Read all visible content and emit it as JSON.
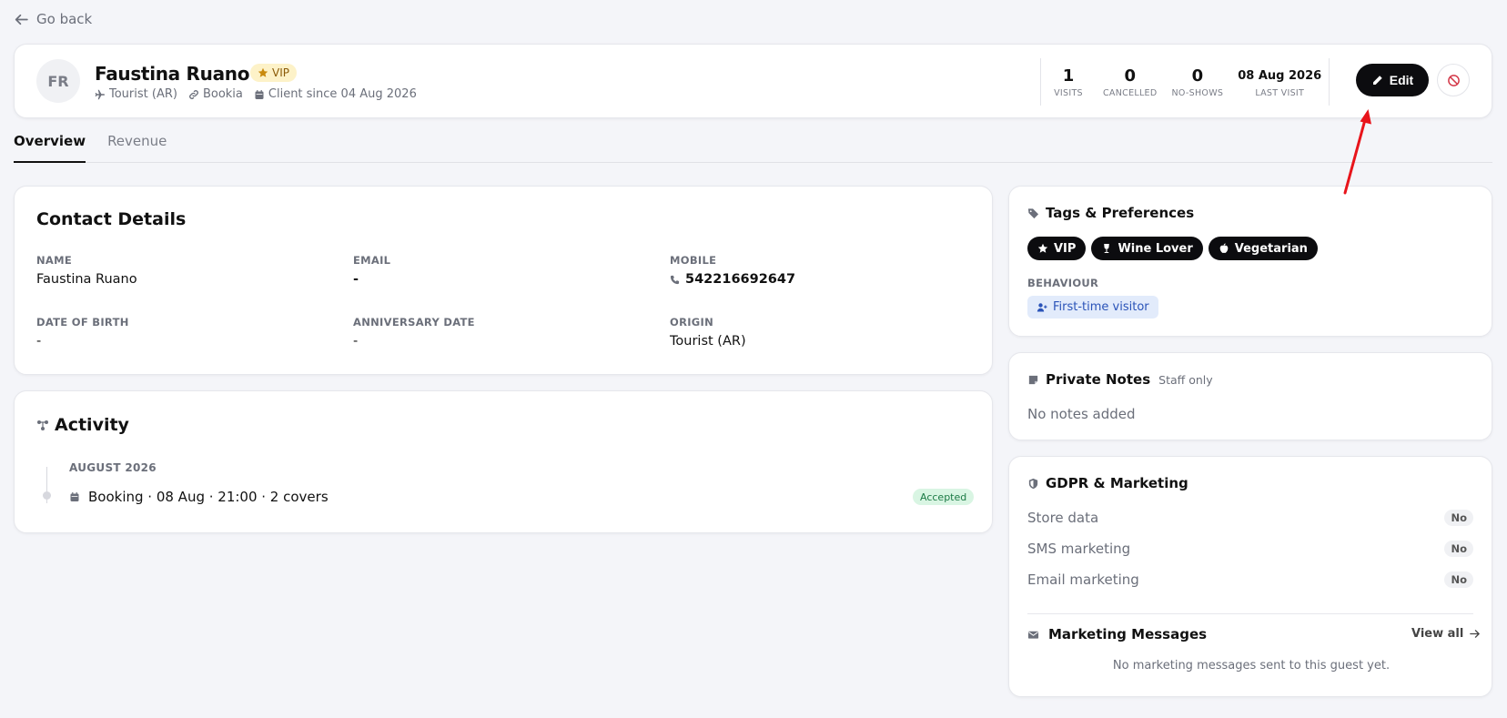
{
  "nav": {
    "back_label": "Go back"
  },
  "guest": {
    "initials": "FR",
    "name": "Faustina Ruano",
    "badge": "VIP",
    "origin": "Tourist (AR)",
    "source": "Bookia",
    "client_since": "Client since 04 Aug 2026"
  },
  "stats": [
    {
      "value": "1",
      "label": "VISITS"
    },
    {
      "value": "0",
      "label": "CANCELLED"
    },
    {
      "value": "0",
      "label": "NO-SHOWS"
    },
    {
      "value": "08 Aug 2026",
      "label": "LAST VISIT"
    }
  ],
  "actions": {
    "edit_label": "Edit"
  },
  "tabs": [
    {
      "label": "Overview",
      "active": true
    },
    {
      "label": "Revenue",
      "active": false
    }
  ],
  "contact": {
    "title": "Contact Details",
    "name_label": "NAME",
    "name_value": "Faustina Ruano",
    "email_label": "EMAIL",
    "email_value": "-",
    "mobile_label": "MOBILE",
    "mobile_value": "542216692647",
    "dob_label": "DATE OF BIRTH",
    "dob_value": "-",
    "anniversary_label": "ANNIVERSARY DATE",
    "anniversary_value": "-",
    "origin_label": "ORIGIN",
    "origin_value": "Tourist (AR)"
  },
  "activity": {
    "title": "Activity",
    "month": "AUGUST 2026",
    "item_text": "Booking · 08 Aug · 21:00 · 2 covers",
    "item_status": "Accepted"
  },
  "tags": {
    "title": "Tags & Preferences",
    "items": [
      "VIP",
      "Wine Lover",
      "Vegetarian"
    ],
    "behaviour_label": "BEHAVIOUR",
    "behaviour_value": "First-time visitor"
  },
  "notes": {
    "title": "Private Notes",
    "subtitle": "Staff only",
    "empty": "No notes added"
  },
  "gdpr": {
    "title": "GDPR & Marketing",
    "rows": [
      {
        "label": "Store data",
        "value": "No"
      },
      {
        "label": "SMS marketing",
        "value": "No"
      },
      {
        "label": "Email marketing",
        "value": "No"
      }
    ],
    "messages_title": "Marketing Messages",
    "view_all": "View all",
    "messages_empty": "No marketing messages sent to this guest yet."
  },
  "colors": {
    "background": "#f4f5f9",
    "primary_button": "#0c0c0f",
    "vip_badge_bg": "#fdf2c8",
    "behaviour_bg": "#e2ebfb",
    "accepted_bg": "#d9f5e3",
    "annotation_arrow": "#e8141b",
    "block_icon": "#d43a4a"
  }
}
